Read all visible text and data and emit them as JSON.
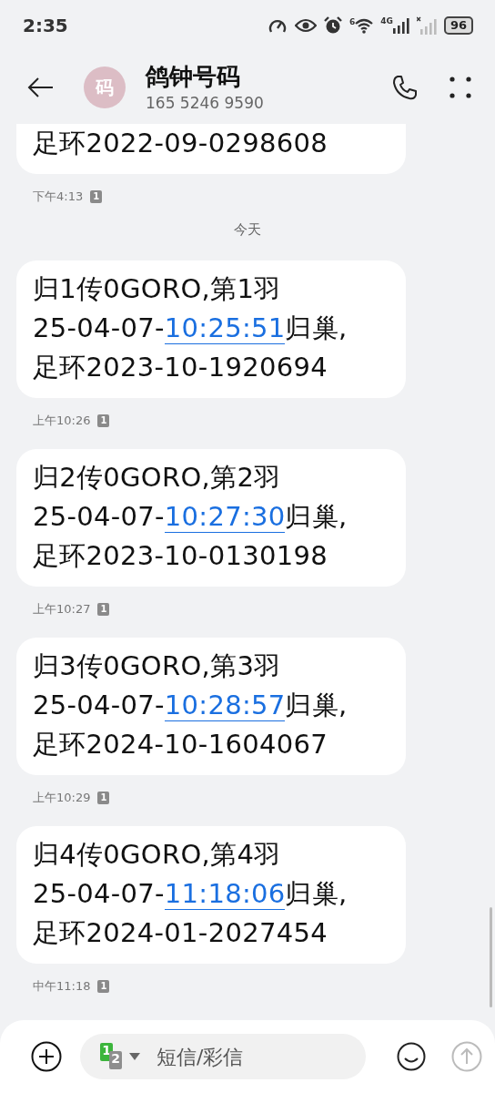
{
  "status_bar": {
    "time": "2:35",
    "battery": "96",
    "wifi_badge": "6",
    "network_label": "4G"
  },
  "header": {
    "avatar": "码",
    "title": "鸽钟号码",
    "number": "165 5246 9590"
  },
  "messages": [
    {
      "kind": "partial",
      "lines": [
        "足环2022-09-0298608"
      ],
      "timestamp": "下午4:13",
      "sim": "1"
    },
    {
      "kind": "divider",
      "label": "今天"
    },
    {
      "kind": "message",
      "line1": "归1传0GORO,第1羽",
      "date": "25-04-07-",
      "time_link": "10:25:51",
      "after_link": "归巢,",
      "line3": "足环2023-10-1920694",
      "timestamp": "上午10:26",
      "sim": "1"
    },
    {
      "kind": "message",
      "line1": "归2传0GORO,第2羽",
      "date": "25-04-07-",
      "time_link": "10:27:30",
      "after_link": "归巢,",
      "line3": "足环2023-10-0130198",
      "timestamp": "上午10:27",
      "sim": "1"
    },
    {
      "kind": "message",
      "line1": "归3传0GORO,第3羽",
      "date": "25-04-07-",
      "time_link": "10:28:57",
      "after_link": "归巢,",
      "line3": "足环2024-10-1604067",
      "timestamp": "上午10:29",
      "sim": "1"
    },
    {
      "kind": "message",
      "line1": "归4传0GORO,第4羽",
      "date": "25-04-07-",
      "time_link": "11:18:06",
      "after_link": "归巢,",
      "line3": "足环2024-01-2027454",
      "timestamp": "中午11:18",
      "sim": "1"
    }
  ],
  "composer": {
    "sim_primary": "1",
    "sim_secondary": "2",
    "placeholder": "短信/彩信"
  }
}
